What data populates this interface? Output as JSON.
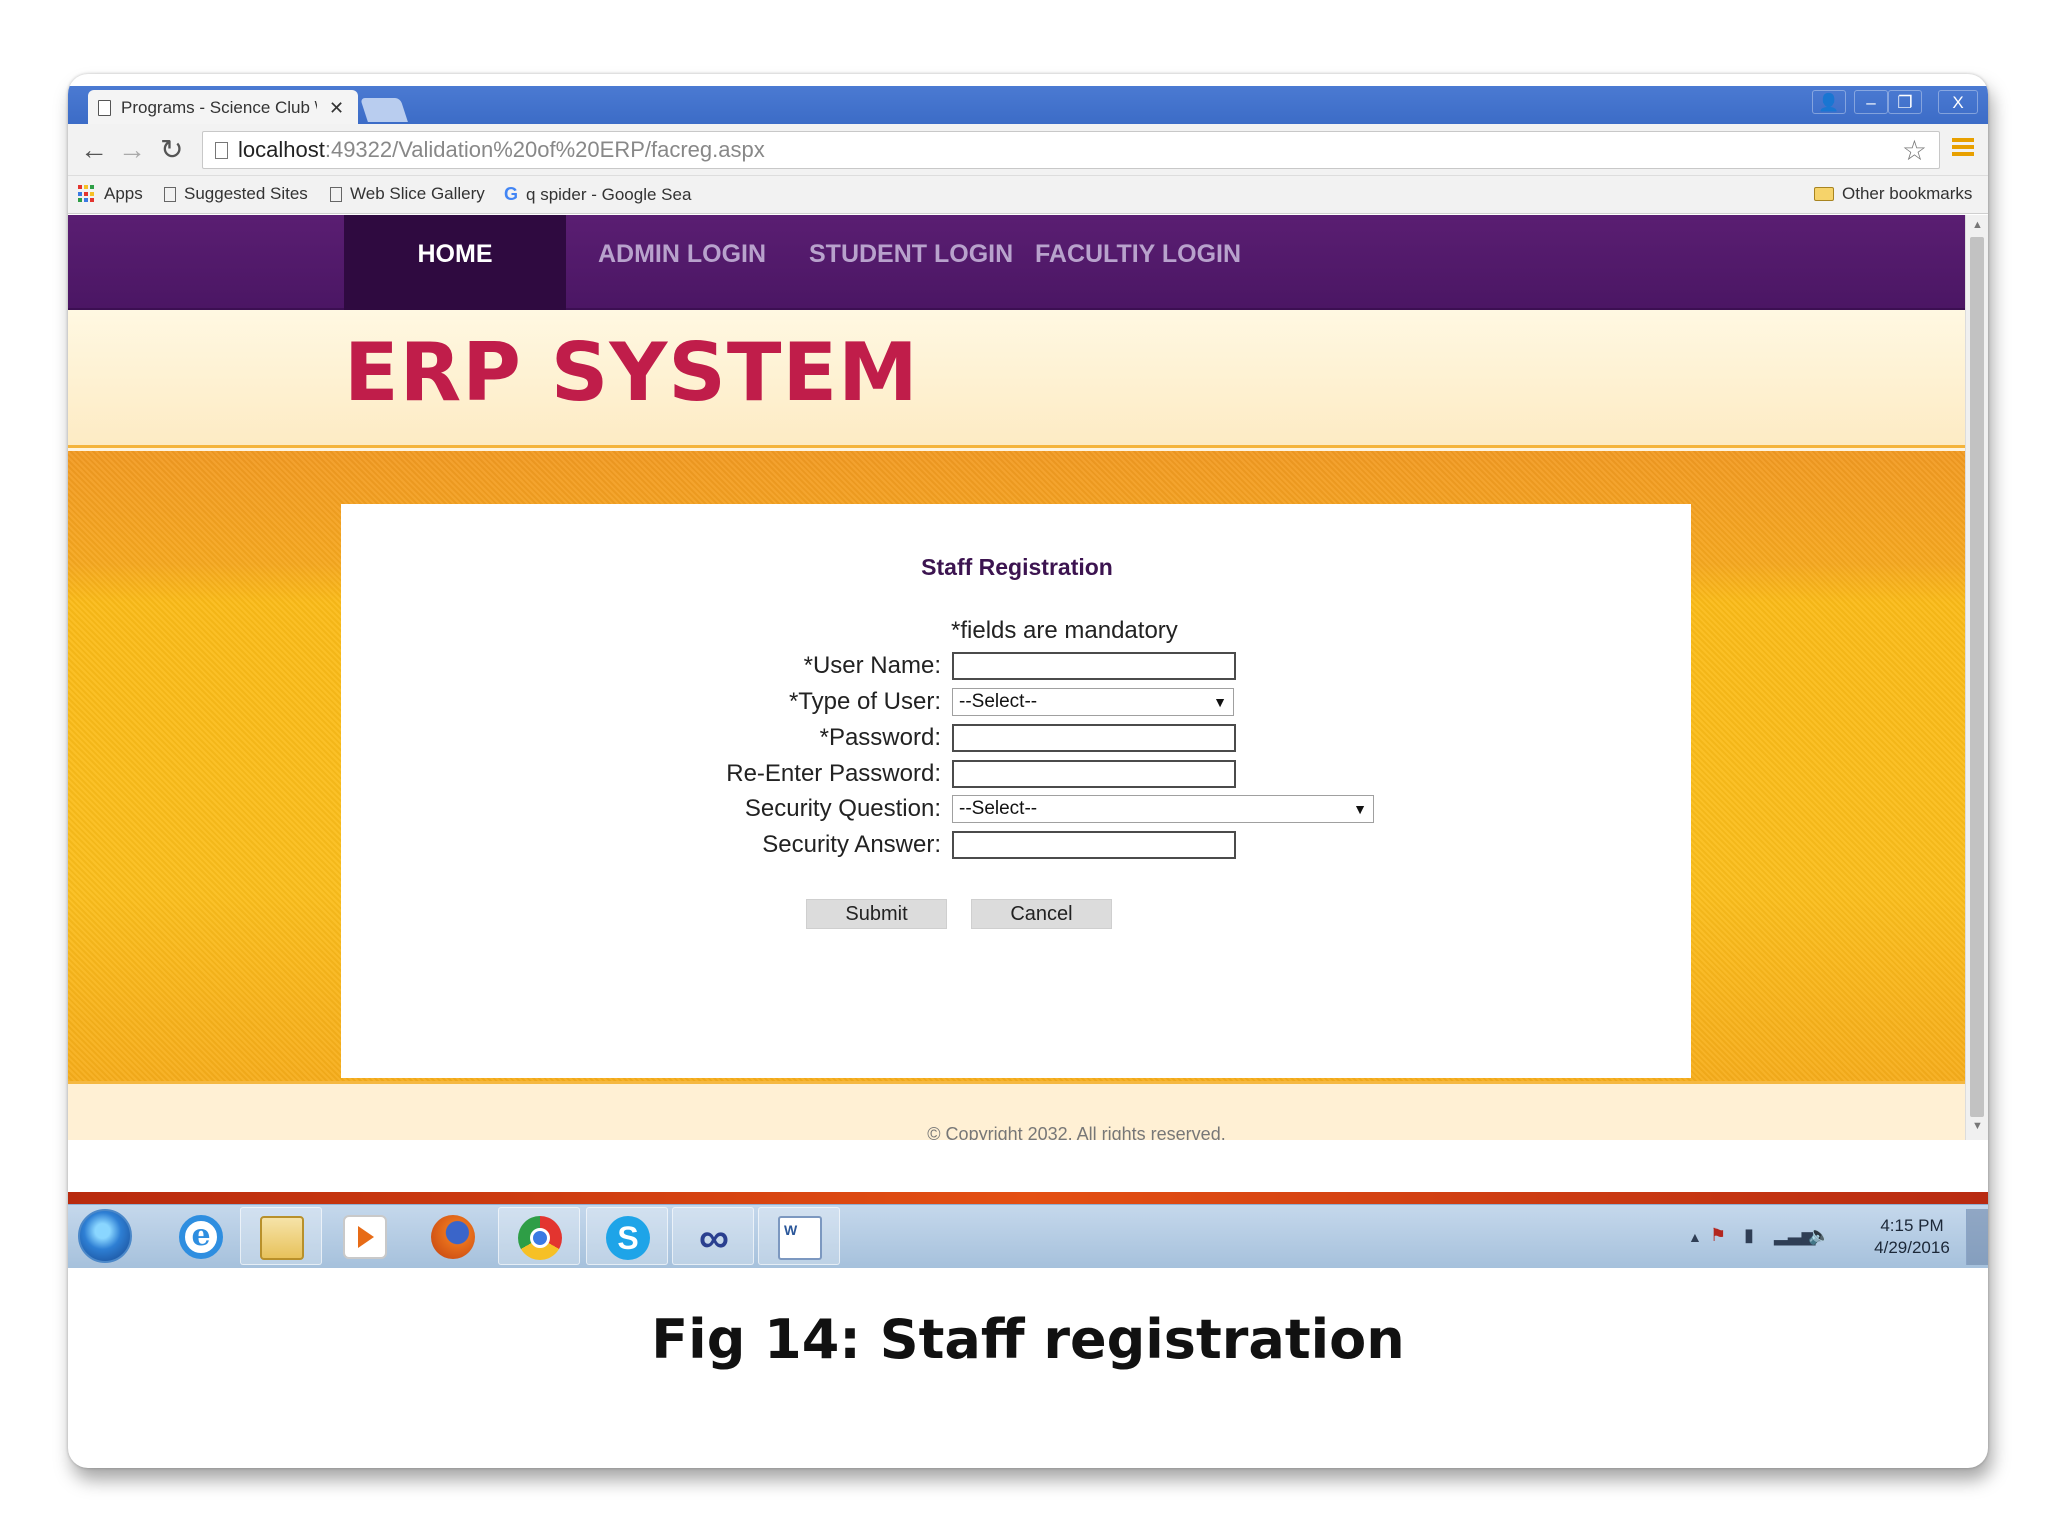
{
  "browser": {
    "tab_title": "Programs - Science Club \\",
    "tab_close": "✕",
    "url_host": "localhost",
    "url_path": ":49322/Validation%20of%20ERP/facreg.aspx",
    "window_controls": {
      "user": "👤",
      "minimize": "–",
      "maximize": "❐",
      "close": "X"
    },
    "nav": {
      "back": "←",
      "forward": "→",
      "reload": "↻",
      "star": "☆"
    },
    "bookmarks": {
      "apps": "Apps",
      "suggested": "Suggested Sites",
      "webslice": "Web Slice Gallery",
      "google": "q spider - Google Sea",
      "google_icon": "G",
      "other": "Other bookmarks"
    }
  },
  "site": {
    "nav": {
      "home": "HOME",
      "admin": "ADMIN LOGIN",
      "student": "STUDENT LOGIN",
      "faculty": "FACULTIY LOGIN"
    },
    "title": "ERP SYSTEM",
    "footer": "© Copyright 2032. All rights reserved."
  },
  "form": {
    "title": "Staff Registration",
    "mandatory_note": "*fields are mandatory",
    "fields": {
      "username_label": "*User Name:",
      "usertype_label": "*Type of User:",
      "usertype_value": "--Select--",
      "password_label": "*Password:",
      "repassword_label": "Re-Enter Password:",
      "secq_label": "Security Question:",
      "secq_value": "--Select--",
      "seca_label": "Security Answer:"
    },
    "dropdown_arrow": "▼",
    "submit": "Submit",
    "cancel": "Cancel"
  },
  "taskbar": {
    "clock_time": "4:15 PM",
    "clock_date": "4/29/2016",
    "ie_glyph": "e",
    "skype_glyph": "S",
    "infinity_glyph": "∞",
    "word_glyph": "W",
    "tray": {
      "up": "▲",
      "flag": "⚑",
      "battery": "▮",
      "network": "▂▃▅",
      "volume": "🔈"
    }
  },
  "caption": "Fig 14: Staff registration",
  "colors": {
    "nav_purple": "#4b1664",
    "title_red": "#c01d4a",
    "orange": "#fbbb18"
  }
}
